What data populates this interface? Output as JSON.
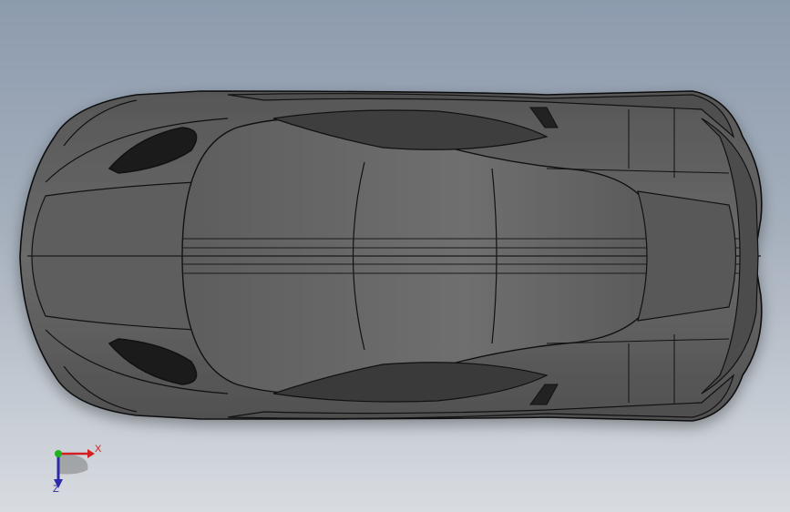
{
  "viewport": {
    "view": "top",
    "model": "car-body",
    "colors": {
      "background_top": "#8d9bae",
      "background_bottom": "#d8dce1",
      "body": "#5f5f5f",
      "body_light": "#6e6e6e",
      "edge": "#111111",
      "intake": "#1b1b1b"
    }
  },
  "triad": {
    "x_label": "X",
    "z_label": "Z",
    "colors": {
      "x": "#d02020",
      "y": "#20b020",
      "z": "#2c2ca8"
    }
  }
}
